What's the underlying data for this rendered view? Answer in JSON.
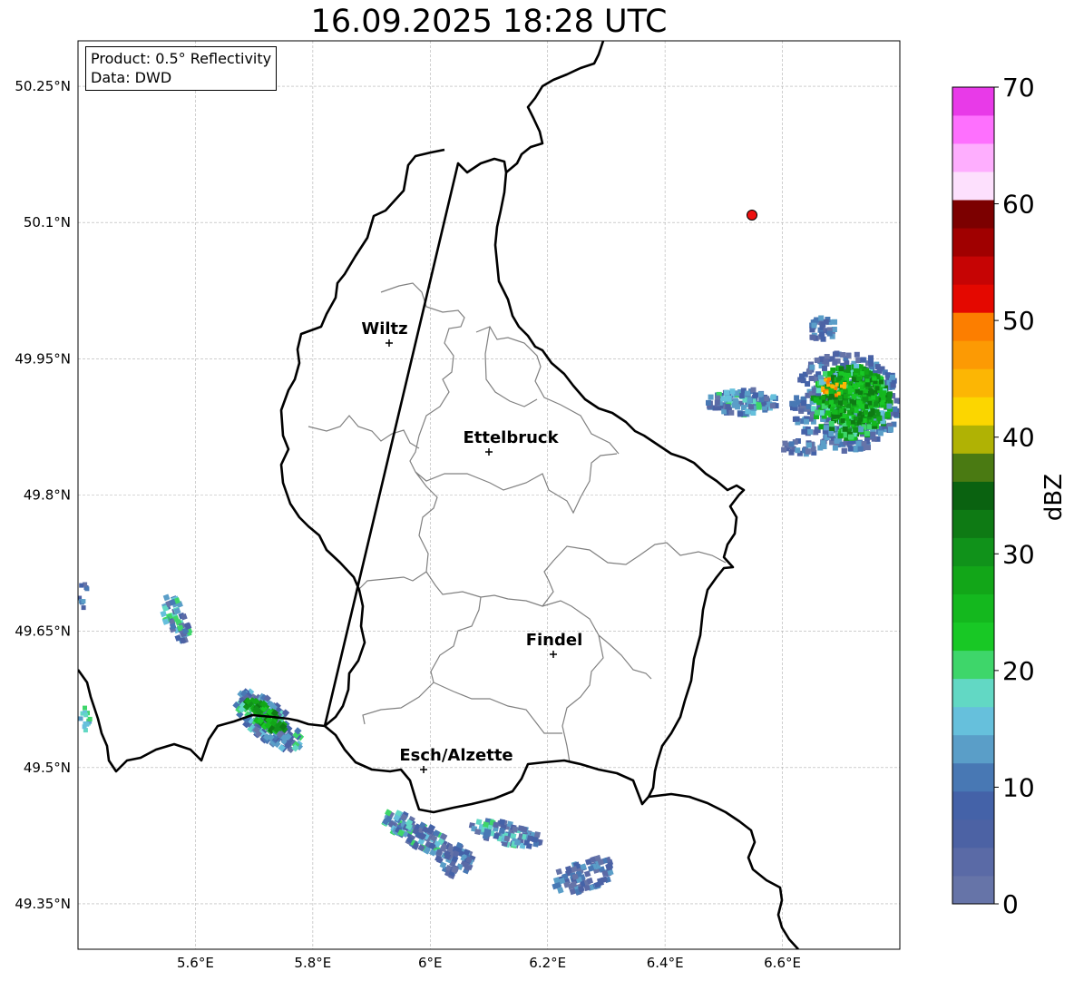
{
  "title": "16.09.2025 18:28 UTC",
  "info": {
    "product": "Product: 0.5° Reflectivity",
    "data": "Data: DWD"
  },
  "axes": {
    "x_ticks": [
      "5.6°E",
      "5.8°E",
      "6°E",
      "6.2°E",
      "6.4°E",
      "6.6°E"
    ],
    "y_ticks": [
      "50.25°N",
      "50.1°N",
      "49.95°N",
      "49.8°N",
      "49.65°N",
      "49.5°N",
      "49.35°N"
    ],
    "lon_range": [
      5.4,
      6.8
    ],
    "lat_range": [
      49.3,
      50.3
    ]
  },
  "cities": [
    {
      "name": "Wiltz"
    },
    {
      "name": "Ettelbruck"
    },
    {
      "name": "Findel"
    },
    {
      "name": "Esch/Alzette"
    }
  ],
  "colorbar": {
    "label": "dBZ",
    "tick_labels": [
      "0",
      "10",
      "20",
      "30",
      "40",
      "50",
      "60",
      "70"
    ],
    "colors": [
      "#6674a8",
      "#5a6aa6",
      "#4c62a4",
      "#4462a8",
      "#4878b4",
      "#5a9ec8",
      "#66c0dc",
      "#62d8c4",
      "#3ed66a",
      "#18c825",
      "#14b81e",
      "#12a618",
      "#10921a",
      "#0e7a14",
      "#0a6210",
      "#4a7a12",
      "#b0b204",
      "#fcd600",
      "#fcb604",
      "#fc9a04",
      "#fc7e00",
      "#e40800",
      "#c60404",
      "#a00000",
      "#7c0000",
      "#fde0fd",
      "#feaefe",
      "#fe70fe",
      "#e83ae8"
    ]
  }
}
